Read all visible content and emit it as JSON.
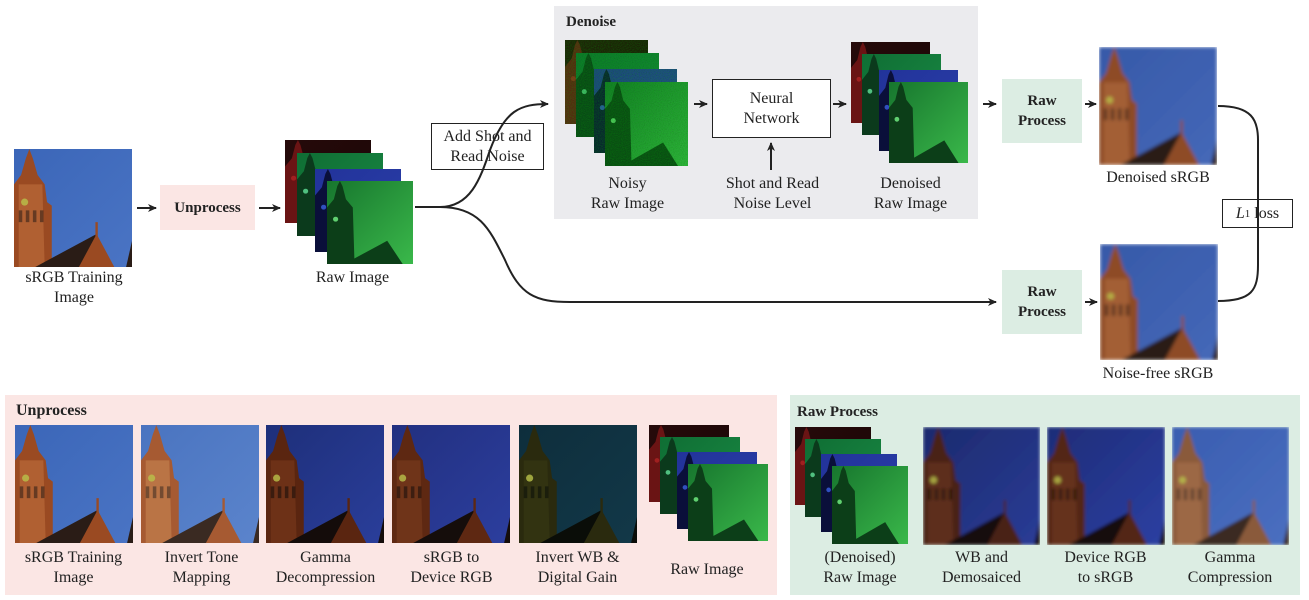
{
  "colors": {
    "unprocess_bg": "#fbe6e4",
    "raw_process_bg": "#dcede3",
    "denoise_bg": "#ebebee",
    "arrow": "#222222"
  },
  "top": {
    "input_label": [
      "sRGB Training",
      "Image"
    ],
    "unprocess_box": "Unprocess",
    "raw_image_label": "Raw Image",
    "noise_box": [
      "Add Shot and",
      "Read Noise"
    ],
    "denoise_panel": {
      "title": "Denoise",
      "noisy_label": [
        "Noisy",
        "Raw Image"
      ],
      "network_box": [
        "Neural",
        "Network"
      ],
      "noise_level_label": [
        "Shot and Read",
        "Noise Level"
      ],
      "denoised_label": [
        "Denoised",
        "Raw Image"
      ]
    },
    "raw_process_top": [
      "Raw",
      "Process"
    ],
    "raw_process_bottom": [
      "Raw",
      "Process"
    ],
    "denoised_srgb_label": "Denoised sRGB",
    "noisefree_srgb_label": "Noise-free sRGB",
    "loss_box": {
      "symbol": "L",
      "subscript": "1",
      "text": "loss"
    }
  },
  "unprocess_panel": {
    "title": "Unprocess",
    "steps": [
      {
        "label": [
          "sRGB Training",
          "Image"
        ],
        "image": "srgb"
      },
      {
        "label": [
          "Invert Tone",
          "Mapping"
        ],
        "image": "tone"
      },
      {
        "label": [
          "Gamma",
          "Decompression"
        ],
        "image": "gamma"
      },
      {
        "label": [
          "sRGB to",
          "Device RGB"
        ],
        "image": "device"
      },
      {
        "label": [
          "Invert WB &",
          "Digital Gain"
        ],
        "image": "wb"
      },
      {
        "label": [
          "Raw Image"
        ],
        "image": "raw"
      }
    ]
  },
  "raw_process_panel": {
    "title": "Raw Process",
    "steps": [
      {
        "label": [
          "(Denoised)",
          "Raw Image"
        ],
        "image": "raw"
      },
      {
        "label": [
          "WB and",
          "Demosaiced"
        ],
        "image": "wbdemosaic"
      },
      {
        "label": [
          "Device RGB",
          "to sRGB"
        ],
        "image": "devsrgb"
      },
      {
        "label": [
          "Gamma",
          "Compression"
        ],
        "image": "gammacomp"
      }
    ]
  }
}
